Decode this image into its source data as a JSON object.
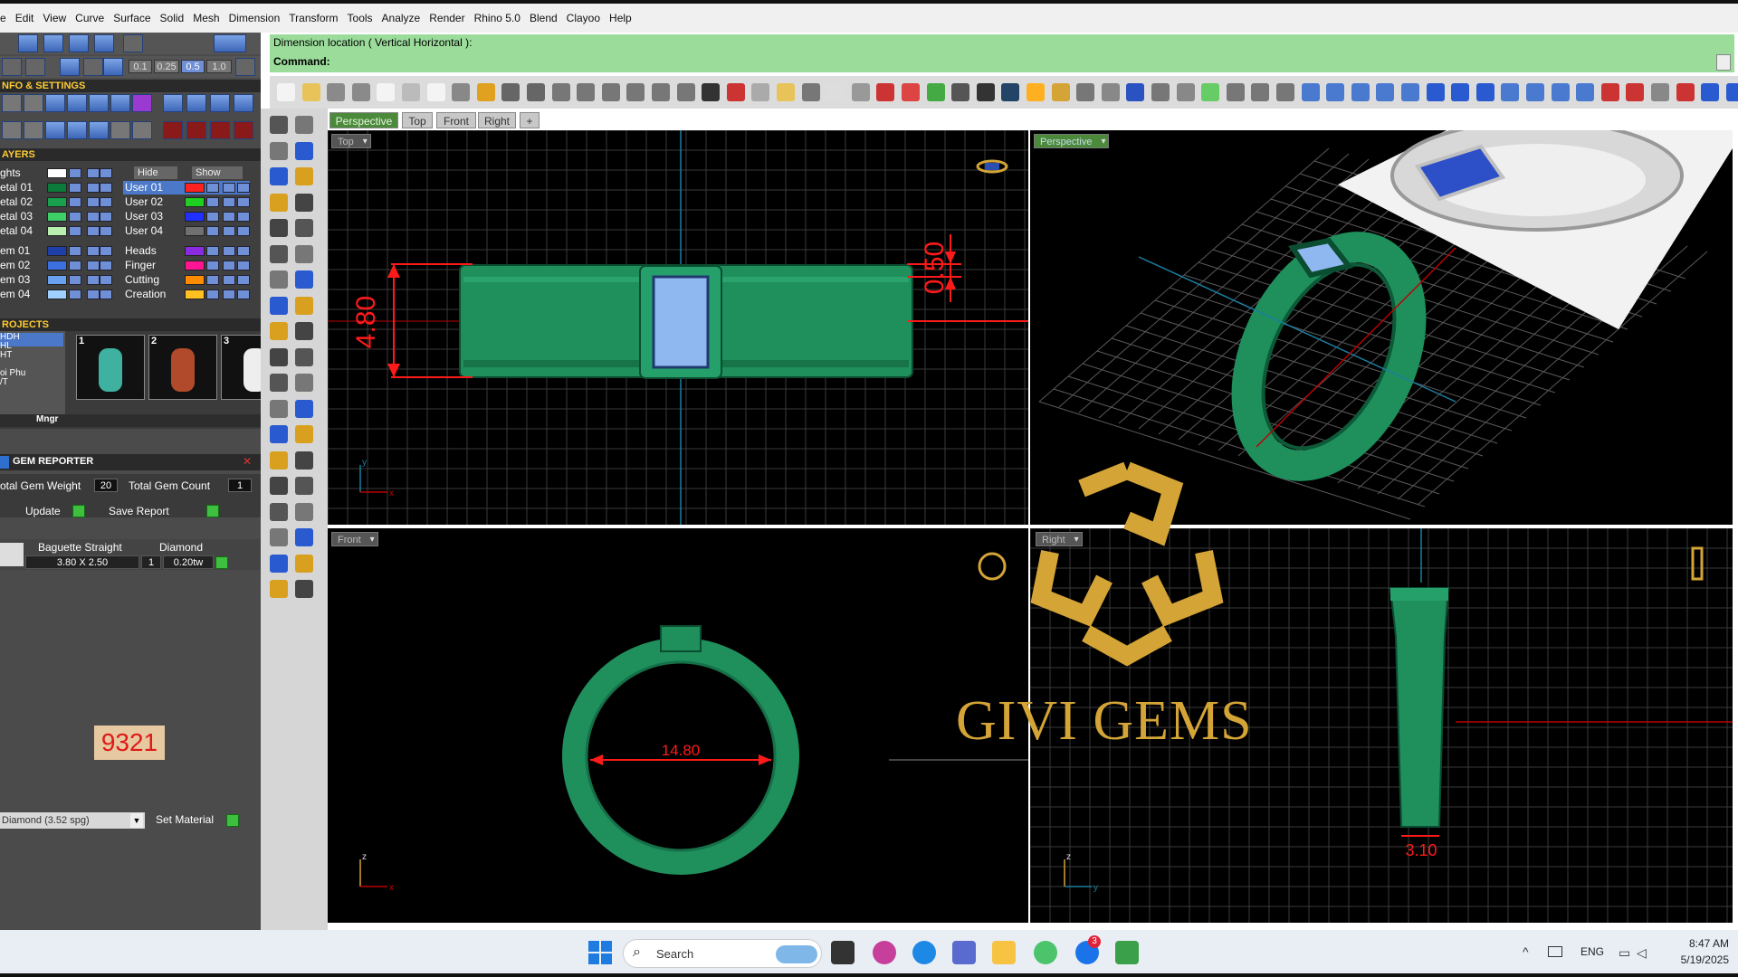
{
  "menu": [
    "e",
    "Edit",
    "View",
    "Curve",
    "Surface",
    "Solid",
    "Mesh",
    "Dimension",
    "Transform",
    "Tools",
    "Analyze",
    "Render",
    "Rhino 5.0",
    "Blend",
    "Clayoo",
    "Help"
  ],
  "command": {
    "prompt_line": "Dimension location ( Vertical  Horizontal ):",
    "command_label": "Command:"
  },
  "top_small_fields": [
    "0.1",
    "0.25",
    "0.5",
    "1.0"
  ],
  "left_panel": {
    "info_header": "NFO & SETTINGS",
    "layers_header": "AYERS",
    "hide_label": "Hide",
    "show_label": "Show",
    "layers_left": [
      {
        "name": "ghts",
        "color": "#ffffff"
      },
      {
        "name": "etal 01",
        "color": "#0b7a3a"
      },
      {
        "name": "etal 02",
        "color": "#19a04e"
      },
      {
        "name": "etal 03",
        "color": "#3fcf68"
      },
      {
        "name": "etal 04",
        "color": "#b9f0b0"
      },
      {
        "name": "em 01",
        "color": "#1f3fa8"
      },
      {
        "name": "em 02",
        "color": "#3c6fe0"
      },
      {
        "name": "em 03",
        "color": "#6aa0f0"
      },
      {
        "name": "em 04",
        "color": "#9fd0ff"
      }
    ],
    "layers_right": [
      {
        "name": "User 01",
        "color": "#ff2020"
      },
      {
        "name": "User 02",
        "color": "#20d020"
      },
      {
        "name": "User 03",
        "color": "#2030ff"
      },
      {
        "name": "User 04",
        "color": "#707070"
      },
      {
        "name": "Heads",
        "color": "#8a2be2"
      },
      {
        "name": "Finger",
        "color": "#ff1493"
      },
      {
        "name": "Cutting",
        "color": "#ff8c00"
      },
      {
        "name": "Creation",
        "color": "#ffc020"
      }
    ],
    "projects_header": "ROJECTS",
    "projects_list": [
      "HDH",
      "HL",
      "HT",
      "",
      "oi Phu",
      "/T"
    ],
    "project_thumbs": [
      "1",
      "2",
      "3"
    ],
    "mngr_label": "Mngr",
    "gem_reporter_header": "GEM REPORTER",
    "total_gem_weight_label": "otal Gem Weight",
    "total_gem_weight_value": "20",
    "total_gem_count_label": "Total Gem Count",
    "total_gem_count_value": "1",
    "update_label": "Update",
    "save_report_label": "Save Report",
    "gem_shape": "Baguette Straight",
    "gem_type": "Diamond",
    "gem_size": "3.80 X 2.50",
    "gem_qty": "1",
    "gem_weight": "0.20tw",
    "red_code": "9321",
    "material_select": "Diamond    (3.52 spg)",
    "set_material_label": "Set Material"
  },
  "tabs": [
    "Perspective",
    "Top",
    "Front",
    "Right",
    "+"
  ],
  "viewports": {
    "top": {
      "label": "Top",
      "dim_height": "4.80",
      "dim_small": "0.50"
    },
    "perspective": {
      "label": "Perspective"
    },
    "front": {
      "label": "Front",
      "dim_inner": "14.80"
    },
    "right": {
      "label": "Right",
      "dim_bottom": "3.10"
    }
  },
  "watermark": {
    "text": "GIVI GEMS"
  },
  "taskbar": {
    "search_placeholder": "Search",
    "lang": "ENG",
    "time": "8:47 AM",
    "date": "5/19/2025",
    "badge": "3"
  },
  "colors": {
    "ring_green": "#1f8f5c",
    "gem_blue": "#8fb8f0",
    "dim_red": "#ff1a1a",
    "grid": "#3a3a3a",
    "watermark_gold": "#d4a437",
    "command_green": "#9bdc9b"
  }
}
